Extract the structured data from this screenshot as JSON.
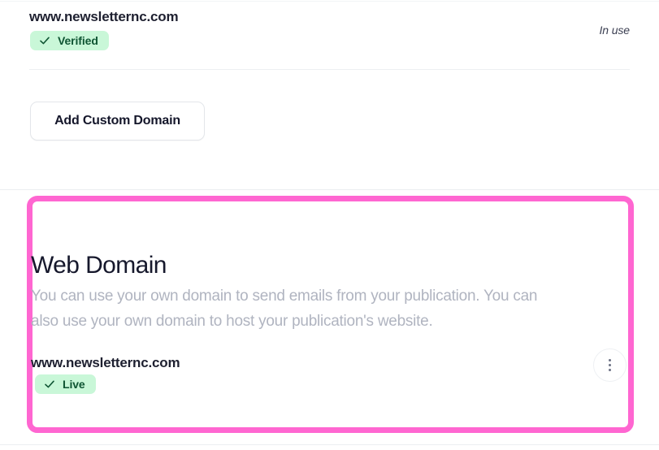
{
  "top_section": {
    "domain": "www.newsletternc.com",
    "status_badge": {
      "label": "Verified",
      "icon": "check-icon",
      "bg_color": "#c9f7d8",
      "text_color": "#0f5533"
    },
    "usage_label": "In use",
    "add_domain_button": "Add Custom Domain"
  },
  "web_domain_section": {
    "title": "Web Domain",
    "description": "You can use your own domain to send emails from your publication. You can also use your own domain to host your publication's website.",
    "domain": "www.newsletternc.com",
    "status_badge": {
      "label": "Live",
      "icon": "check-icon",
      "bg_color": "#c9f7d8",
      "text_color": "#0f5533"
    },
    "menu_icon": "kebab-menu-icon",
    "highlight_color": "#ff66d1"
  }
}
